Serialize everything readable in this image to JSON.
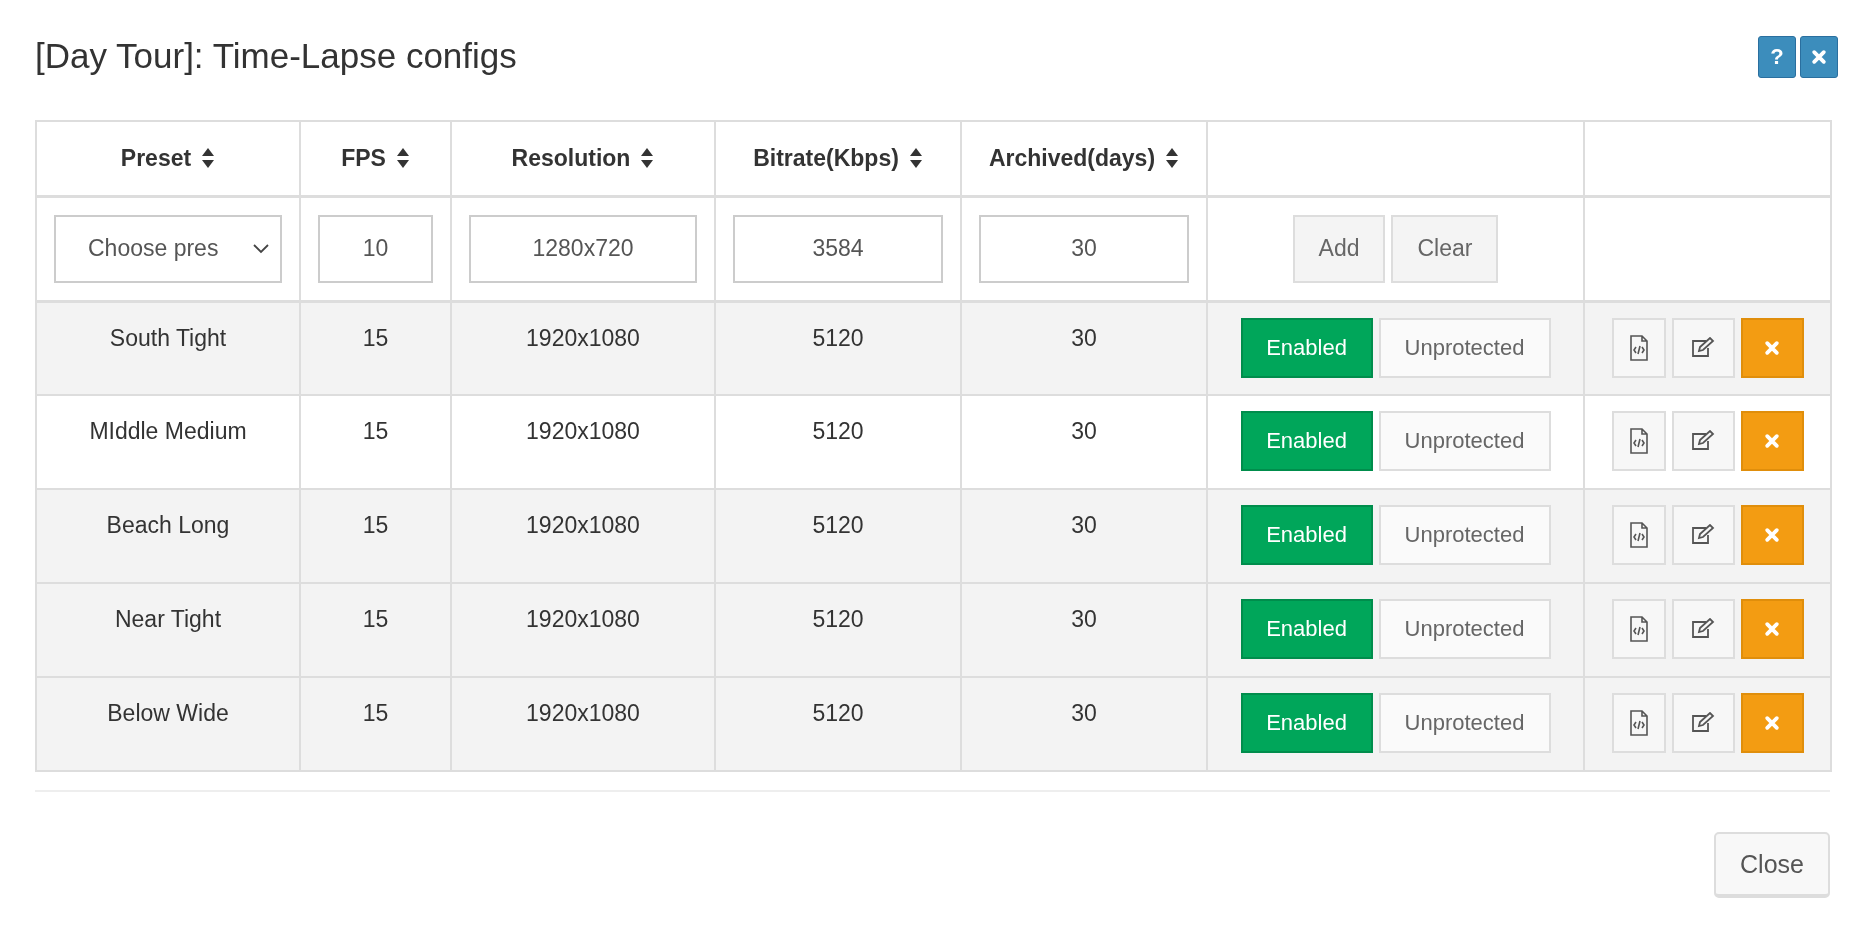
{
  "title": "[Day Tour]: Time-Lapse configs",
  "header_buttons": [
    {
      "kind": "help",
      "label": "?"
    },
    {
      "kind": "close"
    }
  ],
  "columns": [
    {
      "label": "Preset",
      "sortable": true
    },
    {
      "label": "FPS",
      "sortable": true
    },
    {
      "label": "Resolution",
      "sortable": true
    },
    {
      "label": "Bitrate(Kbps)",
      "sortable": true
    },
    {
      "label": "Archived(days)",
      "sortable": true
    },
    {
      "sortable": false
    },
    {
      "sortable": false
    }
  ],
  "new_row": {
    "preset": "Choose pres",
    "fps": "10",
    "resolution": "1280x720",
    "bitrate": "3584",
    "archived": "30",
    "buttons": [
      "Add",
      "Clear"
    ]
  },
  "rows": [
    {
      "preset": "South Tight",
      "fps": "15",
      "resolution": "1920x1080",
      "bitrate": "5120",
      "archived": "30",
      "status": "Enabled",
      "enabled": true,
      "protection": "Unprotected",
      "shaded": true
    },
    {
      "preset": "MIddle Medium",
      "fps": "15",
      "resolution": "1920x1080",
      "bitrate": "5120",
      "archived": "30",
      "status": "Enabled",
      "enabled": true,
      "protection": "Unprotected",
      "shaded": false
    },
    {
      "preset": "Beach Long",
      "fps": "15",
      "resolution": "1920x1080",
      "bitrate": "5120",
      "archived": "30",
      "status": "Enabled",
      "enabled": true,
      "protection": "Unprotected",
      "shaded": true
    },
    {
      "preset": "Near Tight",
      "fps": "15",
      "resolution": "1920x1080",
      "bitrate": "5120",
      "archived": "30",
      "status": "Enabled",
      "enabled": true,
      "protection": "Unprotected",
      "shaded": true
    },
    {
      "preset": "Below Wide",
      "fps": "15",
      "resolution": "1920x1080",
      "bitrate": "5120",
      "archived": "30",
      "status": "Enabled",
      "enabled": true,
      "protection": "Unprotected",
      "shaded": true
    }
  ],
  "footer_button": "Close"
}
